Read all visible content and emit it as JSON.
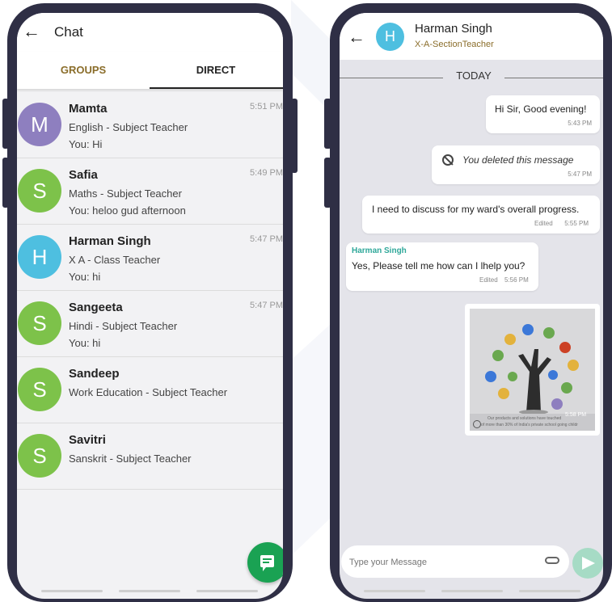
{
  "colors": {
    "phone_frame": "#2f2f45",
    "groups_tab": "#8a6d2a",
    "fab_green": "#1aa253",
    "sender_teal": "#2fa89a",
    "avatar_purple": "#8e7fbf",
    "avatar_green": "#7dc24a",
    "avatar_blue": "#4ebfe0"
  },
  "left": {
    "title": "Chat",
    "back_icon": "arrow-left-icon",
    "tabs": [
      "GROUPS",
      "DIRECT"
    ],
    "active_tab": "DIRECT",
    "chats": [
      {
        "initial": "M",
        "name": "Mamta",
        "role": "English - Subject Teacher",
        "last": "You: Hi",
        "time": "5:51 PM",
        "color": "#8e7fbf"
      },
      {
        "initial": "S",
        "name": "Safia",
        "role": "Maths - Subject Teacher",
        "last": "You: heloo gud afternoon",
        "time": "5:49 PM",
        "color": "#7dc24a"
      },
      {
        "initial": "H",
        "name": "Harman Singh",
        "role": "X A - Class Teacher",
        "last": "You: hi",
        "time": "5:47 PM",
        "color": "#4ebfe0"
      },
      {
        "initial": "S",
        "name": "Sangeeta",
        "role": "Hindi - Subject Teacher",
        "last": "You: hi",
        "time": "5:47 PM",
        "color": "#7dc24a"
      },
      {
        "initial": "S",
        "name": "Sandeep",
        "role": "Work Education - Subject Teacher",
        "last": "",
        "time": "",
        "color": "#7dc24a"
      },
      {
        "initial": "S",
        "name": "Savitri",
        "role": "Sanskrit - Subject Teacher",
        "last": "",
        "time": "",
        "color": "#7dc24a"
      }
    ],
    "fab_icon": "chat-bubble-icon"
  },
  "right": {
    "contact_initial": "H",
    "contact_name": "Harman Singh",
    "contact_subtitle": "X-A-SectionTeacher",
    "day_separator": "TODAY",
    "messages": [
      {
        "text": "Hi Sir, Good evening!",
        "meta": "5:43 PM"
      },
      {
        "text": "You deleted this message",
        "meta": "5:47 PM"
      },
      {
        "text": "I need to discuss for my ward's overall progress.",
        "edited": "Edited",
        "meta": "5:55 PM"
      },
      {
        "sender": "Harman Singh",
        "text": "Yes, Please tell me how can I lhelp you?",
        "edited": "Edited",
        "meta": "5:56 PM"
      }
    ],
    "image_message": {
      "caption_line1": "Our products and solutions have touched",
      "caption_line2": "of more than 30% of India's private school going childr",
      "time": "5:58 PM"
    },
    "composer_placeholder": "Type your Message",
    "attach_icon": "paperclip-icon",
    "send_icon": "send-icon"
  }
}
